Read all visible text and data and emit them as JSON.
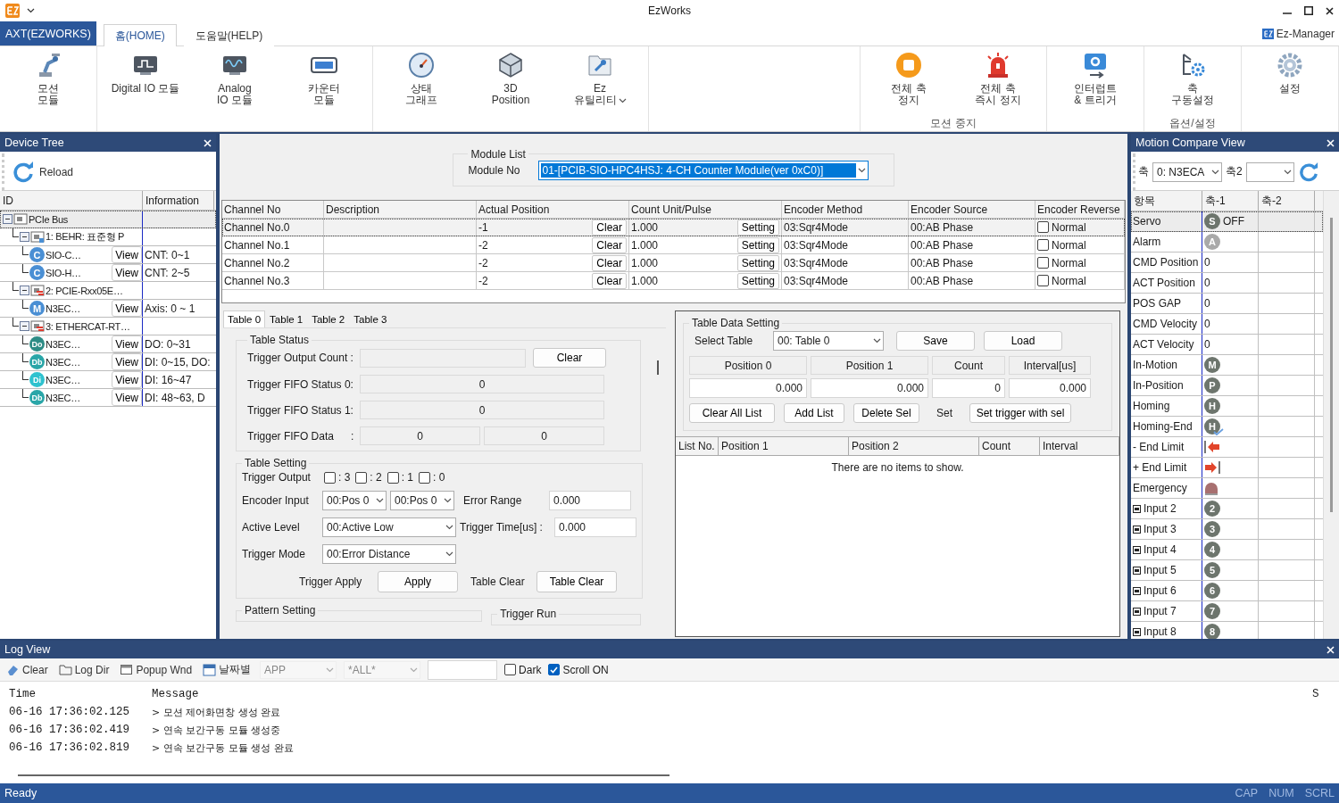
{
  "window": {
    "title": "EzWorks"
  },
  "ribbon": {
    "app_tab": "AXT(EZWORKS)",
    "tabs": [
      {
        "label": "홈(HOME)",
        "selected": true
      },
      {
        "label": "도움말(HELP)",
        "selected": false
      }
    ],
    "manager": "Ez-Manager",
    "groups_left": [
      {
        "buttons": [
          {
            "kind": "robot",
            "lines": [
              "모션",
              "모듈"
            ]
          }
        ]
      },
      {
        "buttons": [
          {
            "kind": "digital-io",
            "lines": [
              "Digital IO 모듈"
            ]
          },
          {
            "kind": "analog-io",
            "lines": [
              "Analog",
              "IO 모듈"
            ]
          },
          {
            "kind": "counter",
            "lines": [
              "카운터",
              "모듈"
            ]
          }
        ]
      },
      {
        "buttons": [
          {
            "kind": "gauge",
            "lines": [
              "상태",
              "그래프"
            ]
          },
          {
            "kind": "cube",
            "lines": [
              "3D",
              "Position"
            ]
          },
          {
            "kind": "wrench",
            "lines": [
              "Ez",
              "유틸리티"
            ],
            "dropdown": true
          }
        ]
      }
    ],
    "groups_right": [
      {
        "caption": "모션 중지",
        "buttons": [
          {
            "kind": "stop",
            "lines": [
              "전체 축",
              "정지"
            ]
          },
          {
            "kind": "siren",
            "lines": [
              "전체 축",
              "즉시 정지"
            ]
          }
        ]
      },
      {
        "buttons": [
          {
            "kind": "interrupt",
            "lines": [
              "인터럽트",
              "& 트리거"
            ]
          }
        ]
      },
      {
        "caption": "옵션/설정",
        "buttons": [
          {
            "kind": "axis-config",
            "lines": [
              "축",
              "구동설정"
            ]
          }
        ]
      },
      {
        "buttons": [
          {
            "kind": "gear",
            "lines": [
              "설정"
            ]
          }
        ]
      }
    ]
  },
  "device_tree": {
    "title": "Device Tree",
    "reload": "Reload",
    "columns": [
      "ID",
      "Information"
    ],
    "nodes": [
      {
        "label": "PCIe Bus",
        "kind": "bus",
        "expanded": true,
        "selected": true,
        "children": [
          {
            "label": "1: BEHR: 표준형 P",
            "kind": "board",
            "expanded": true,
            "selected": false,
            "children": [
              {
                "label": "SIO-C…",
                "badge": "C",
                "color": "#4a8fd4",
                "button": "View",
                "info": "CNT: 0~1",
                "selected": false
              },
              {
                "label": "SIO-H…",
                "badge": "C",
                "color": "#4a8fd4",
                "button": "View",
                "info": "CNT: 2~5",
                "selected": false
              }
            ]
          },
          {
            "label": "2: PCIE-Rxx05E…",
            "kind": "board-link",
            "expanded": true,
            "selected": false,
            "children": [
              {
                "label": "N3EC…",
                "badge": "M",
                "color": "#4a8fd4",
                "button": "View",
                "info": "Axis: 0 ~ 1",
                "selected": false
              }
            ]
          },
          {
            "label": "3: ETHERCAT-RT…",
            "kind": "ethercat",
            "expanded": true,
            "selected": false,
            "children": [
              {
                "label": "N3EC…",
                "badge": "Do",
                "color": "#2e8c86",
                "button": "View",
                "info": "DO: 0~31",
                "selected": false
              },
              {
                "label": "N3EC…",
                "badge": "Db",
                "color": "#2aa6a8",
                "button": "View",
                "info": "DI: 0~15, DO:",
                "selected": false
              },
              {
                "label": "N3EC…",
                "badge": "Di",
                "color": "#2fc2cf",
                "button": "View",
                "info": "DI: 16~47",
                "selected": false
              },
              {
                "label": "N3EC…",
                "badge": "Db",
                "color": "#2aa6a8",
                "button": "View",
                "info": "DI: 48~63, D",
                "selected": false
              }
            ]
          }
        ]
      }
    ]
  },
  "module_list": {
    "title": "Module List",
    "label": "Module No",
    "value": "01-[PCIB-SIO-HPC4HSJ: 4-CH Counter Module(ver 0xC0)]"
  },
  "channels": {
    "columns": [
      "Channel No",
      "Description",
      "Actual Position",
      "Count Unit/Pulse",
      "Encoder Method",
      "Encoder Source",
      "Encoder Reverse"
    ],
    "rows": [
      {
        "name": "Channel No.0",
        "actual": "-1",
        "clear": "Clear",
        "unit": "1.000",
        "setting": "Setting",
        "method": "03:Sqr4Mode",
        "source": "00:AB Phase",
        "reverse": false,
        "reverse_label": "Normal",
        "selected": true
      },
      {
        "name": "Channel No.1",
        "actual": "-2",
        "clear": "Clear",
        "unit": "1.000",
        "setting": "Setting",
        "method": "03:Sqr4Mode",
        "source": "00:AB Phase",
        "reverse": false,
        "reverse_label": "Normal",
        "selected": false
      },
      {
        "name": "Channel No.2",
        "actual": "-2",
        "clear": "Clear",
        "unit": "1.000",
        "setting": "Setting",
        "method": "03:Sqr4Mode",
        "source": "00:AB Phase",
        "reverse": false,
        "reverse_label": "Normal",
        "selected": false
      },
      {
        "name": "Channel No.3",
        "actual": "-2",
        "clear": "Clear",
        "unit": "1.000",
        "setting": "Setting",
        "method": "03:Sqr4Mode",
        "source": "00:AB Phase",
        "reverse": false,
        "reverse_label": "Normal",
        "selected": false
      }
    ]
  },
  "table_tabs": [
    {
      "label": "Table 0",
      "selected": true
    },
    {
      "label": "Table 1",
      "selected": false
    },
    {
      "label": "Table 2",
      "selected": false
    },
    {
      "label": "Table 3",
      "selected": false
    }
  ],
  "table_status": {
    "title": "Table Status",
    "output_count": {
      "label": "Trigger Output Count :",
      "button": "Clear"
    },
    "fifo": [
      {
        "label": "Trigger FIFO Status 0:",
        "value": "0"
      },
      {
        "label": "Trigger FIFO Status 1:",
        "value": "0"
      }
    ],
    "fifo_data": {
      "label": "Trigger FIFO Data",
      "colon": ":",
      "values": [
        "0",
        "0"
      ]
    }
  },
  "table_setting": {
    "title": "Table Setting",
    "trigger_output": {
      "label": "Trigger Output",
      "bits": [
        {
          "label": ": 3",
          "checked": false
        },
        {
          "label": ": 2",
          "checked": false
        },
        {
          "label": ": 1",
          "checked": false
        },
        {
          "label": ": 0",
          "checked": false
        }
      ]
    },
    "encoder_input": {
      "label": "Encoder Input",
      "values": [
        "00:Pos 0",
        "00:Pos 0"
      ]
    },
    "error_range": {
      "label": "Error Range",
      "value": "0.000"
    },
    "active_level": {
      "label": "Active Level",
      "value": "00:Active Low"
    },
    "trigger_time": {
      "label": "Trigger Time[us] :",
      "value": "0.000"
    },
    "trigger_mode": {
      "label": "Trigger Mode",
      "value": "00:Error Distance"
    },
    "apply": {
      "label": "Trigger Apply",
      "button": "Apply"
    },
    "clear": {
      "label": "Table Clear",
      "button": "Table Clear"
    }
  },
  "pattern_setting": {
    "title": "Pattern Setting"
  },
  "trigger_run": {
    "title": "Trigger Run"
  },
  "data_setting": {
    "title": "Table Data Setting",
    "select_label": "Select Table",
    "select_value": "00: Table 0",
    "top_buttons": [
      "Save",
      "Load"
    ],
    "columns": [
      "Position 0",
      "Position 1",
      "Count",
      "Interval[us]"
    ],
    "values": [
      "0.000",
      "0.000",
      "0",
      "0.000"
    ],
    "buttons": [
      "Clear All List",
      "Add List",
      "Delete Sel"
    ],
    "set_label": "Set",
    "set_button": "Set trigger with sel",
    "list": {
      "columns": [
        "List No.",
        "Position 1",
        "Position 2",
        "Count",
        "Interval"
      ],
      "empty": "There are no items to show."
    }
  },
  "motion_compare": {
    "title": "Motion Compare View",
    "axis_label": "축",
    "axis_value": "0: N3ECA",
    "axis2_label": "축2",
    "columns": [
      "항목",
      "축-1",
      "축-2"
    ],
    "rows": [
      {
        "item": "Servo",
        "kind": "led",
        "letter": "S",
        "color": "#6d756d",
        "value": "OFF",
        "selected": true
      },
      {
        "item": "Alarm",
        "kind": "led",
        "letter": "A",
        "color": "#a9a9a9",
        "selected": false
      },
      {
        "item": "CMD Position",
        "kind": "value",
        "value": "0",
        "selected": false
      },
      {
        "item": "ACT Position",
        "kind": "value",
        "value": "0",
        "selected": false
      },
      {
        "item": "POS GAP",
        "kind": "value",
        "value": "0",
        "selected": false
      },
      {
        "item": "CMD Velocity",
        "kind": "value",
        "value": "0",
        "selected": false
      },
      {
        "item": "ACT Velocity",
        "kind": "value",
        "value": "0",
        "selected": false
      },
      {
        "item": "In-Motion",
        "kind": "led",
        "letter": "M",
        "color": "#6d756d",
        "selected": false
      },
      {
        "item": "In-Position",
        "kind": "led",
        "letter": "P",
        "color": "#6d756d",
        "selected": false
      },
      {
        "item": "Homing",
        "kind": "led",
        "letter": "H",
        "color": "#6d756d",
        "selected": false
      },
      {
        "item": "Homing-End",
        "kind": "led_check",
        "letter": "H",
        "color": "#6d756d",
        "selected": false
      },
      {
        "item": "- End Limit",
        "kind": "limit_minus",
        "selected": false
      },
      {
        "item": "+ End Limit",
        "kind": "limit_plus",
        "selected": false
      },
      {
        "item": "Emergency",
        "kind": "emergency",
        "selected": false
      },
      {
        "item": "Input 2",
        "kind": "input",
        "letter": "2",
        "color": "#6d756d",
        "selected": false
      },
      {
        "item": "Input 3",
        "kind": "input",
        "letter": "3",
        "color": "#6d756d",
        "selected": false
      },
      {
        "item": "Input 4",
        "kind": "input",
        "letter": "4",
        "color": "#6d756d",
        "selected": false
      },
      {
        "item": "Input 5",
        "kind": "input",
        "letter": "5",
        "color": "#6d756d",
        "selected": false
      },
      {
        "item": "Input 6",
        "kind": "input",
        "letter": "6",
        "color": "#6d756d",
        "selected": false
      },
      {
        "item": "Input 7",
        "kind": "input",
        "letter": "7",
        "color": "#6d756d",
        "selected": false
      },
      {
        "item": "Input 8",
        "kind": "input",
        "letter": "8",
        "color": "#6d756d",
        "selected": false
      }
    ]
  },
  "log": {
    "title": "Log View",
    "tools": [
      {
        "kind": "eraser",
        "label": "Clear"
      },
      {
        "kind": "folder",
        "label": "Log Dir"
      },
      {
        "kind": "window",
        "label": "Popup Wnd"
      },
      {
        "kind": "calendar",
        "label": "날짜별"
      }
    ],
    "filters": [
      "APP",
      "*ALL*"
    ],
    "dark": {
      "label": "Dark",
      "checked": false
    },
    "scroll": {
      "label": "Scroll ON",
      "checked": true
    },
    "columns": [
      "Time",
      "Message",
      "S"
    ],
    "rows": [
      {
        "time": "06-16 17:36:02.125",
        "message": "> 모션 제어화면창 생성 완료"
      },
      {
        "time": "06-16 17:36:02.419",
        "message": "> 연속 보간구동 모듈 생성중"
      },
      {
        "time": "06-16 17:36:02.819",
        "message": "> 연속 보간구동 모듈 생성 완료"
      }
    ]
  },
  "status_bar": {
    "text": "Ready",
    "indicators": [
      "CAP",
      "NUM",
      "SCRL"
    ]
  }
}
